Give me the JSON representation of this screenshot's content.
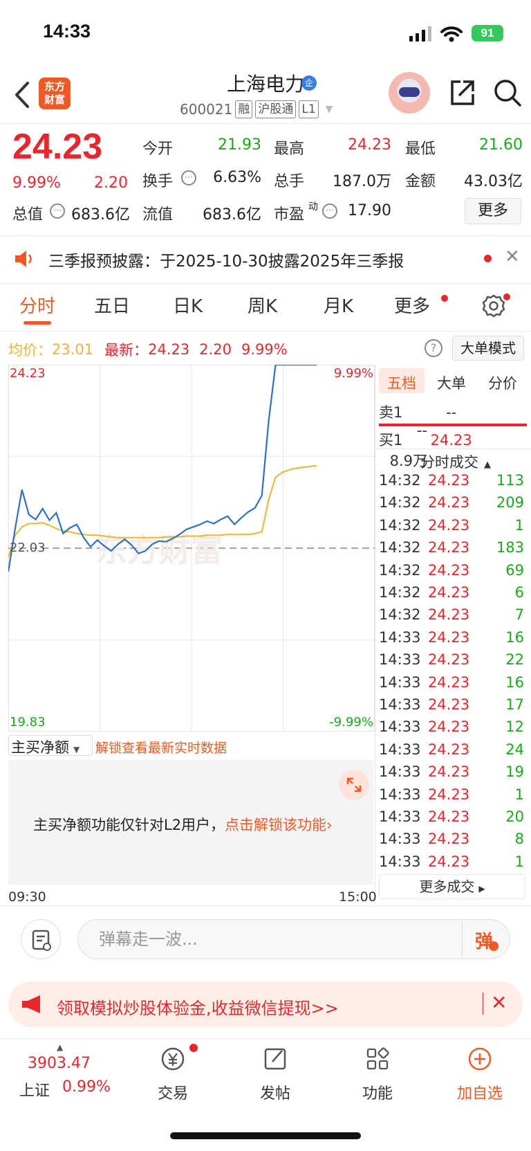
{
  "status_bar": {
    "time": "14:33",
    "battery": "91"
  },
  "header": {
    "logo_line1": "东方",
    "logo_line2": "财富",
    "stock_name": "上海电力",
    "name_badge": "企",
    "stock_code": "600021",
    "tags": [
      "融",
      "沪股通",
      "L1"
    ]
  },
  "quote": {
    "price": "24.23",
    "change_pct": "9.99%",
    "change": "2.20",
    "open_label": "今开",
    "open": "21.93",
    "high_label": "最高",
    "high": "24.23",
    "low_label": "最低",
    "low": "21.60",
    "turnover_label": "换手",
    "turnover": "6.63%",
    "volume_label": "总手",
    "volume": "187.0万",
    "amount_label": "金额",
    "amount": "43.03亿",
    "mktcap_label": "总值",
    "mktcap": "683.6亿",
    "float_label": "流值",
    "float_cap": "683.6亿",
    "pe_label": "市盈",
    "pe_sup": "动",
    "pe": "17.90",
    "more_label": "更多"
  },
  "notice": {
    "text": "三季报预披露：于2025-10-30披露2025年三季报"
  },
  "tabs": [
    "分时",
    "五日",
    "日K",
    "周K",
    "月K",
    "更多"
  ],
  "info": {
    "avg_label": "均价：",
    "avg": "23.01",
    "latest_label": "最新：",
    "latest": "24.23",
    "latest_chg": "2.20",
    "latest_pct": "9.99%",
    "mode_label": "大单模式",
    "help_icon": "?"
  },
  "chart_data": {
    "type": "line",
    "title": "",
    "y_top_label": "24.23",
    "y_mid_label": "22.03",
    "y_bottom_label": "19.83",
    "pct_top_label": "9.99%",
    "pct_bottom_label": "-9.99%",
    "ylim": [
      19.83,
      24.23
    ],
    "prev_close": 22.03,
    "x_start_label": "09:30",
    "x_end_label": "15:00",
    "series": [
      {
        "color": "#2f6fc4",
        "values": [
          21.73,
          22.25,
          22.72,
          22.42,
          22.36,
          22.49,
          22.35,
          22.44,
          22.19,
          22.26,
          22.3,
          22.14,
          22.03,
          22.11,
          22.04,
          21.98,
          22.06,
          22.12,
          22.05,
          21.95,
          21.98,
          22.06,
          22.1,
          22.09,
          22.13,
          22.18,
          22.24,
          22.27,
          22.3,
          22.34,
          22.31,
          22.36,
          22.4,
          22.3,
          22.38,
          22.45,
          22.5,
          22.65,
          23.55,
          24.23,
          24.23,
          24.23,
          24.23,
          24.23,
          24.23,
          24.23
        ]
      },
      {
        "color": "#f2b332",
        "values": [
          21.9,
          22.17,
          22.27,
          22.31,
          22.31,
          22.32,
          22.29,
          22.25,
          22.22,
          22.21,
          22.19,
          22.18,
          22.17,
          22.17,
          22.16,
          22.15,
          22.14,
          22.14,
          22.14,
          22.14,
          22.14,
          22.14,
          22.14,
          22.15,
          22.15,
          22.15,
          22.16,
          22.16,
          22.16,
          22.17,
          22.17,
          22.17,
          22.18,
          22.18,
          22.18,
          22.18,
          22.19,
          22.21,
          22.6,
          22.87,
          22.93,
          22.96,
          22.98,
          22.99,
          23.0,
          23.01
        ]
      }
    ],
    "grid": true
  },
  "order_book": {
    "tabs": [
      "五档",
      "大单",
      "分价"
    ],
    "sell1_label": "卖1",
    "sell1_price": "--",
    "sell1_vol": "--",
    "buy1_label": "买1",
    "buy1_price": "24.23",
    "buy1_vol": "8.9万",
    "trades_title": "分时成交",
    "trades": [
      {
        "time": "14:32",
        "price": "24.23",
        "vol": "113"
      },
      {
        "time": "14:32",
        "price": "24.23",
        "vol": "209"
      },
      {
        "time": "14:32",
        "price": "24.23",
        "vol": "1"
      },
      {
        "time": "14:32",
        "price": "24.23",
        "vol": "183"
      },
      {
        "time": "14:32",
        "price": "24.23",
        "vol": "69"
      },
      {
        "time": "14:32",
        "price": "24.23",
        "vol": "6"
      },
      {
        "time": "14:32",
        "price": "24.23",
        "vol": "7"
      },
      {
        "time": "14:33",
        "price": "24.23",
        "vol": "16"
      },
      {
        "time": "14:33",
        "price": "24.23",
        "vol": "22"
      },
      {
        "time": "14:33",
        "price": "24.23",
        "vol": "16"
      },
      {
        "time": "14:33",
        "price": "24.23",
        "vol": "17"
      },
      {
        "time": "14:33",
        "price": "24.23",
        "vol": "12"
      },
      {
        "time": "14:33",
        "price": "24.23",
        "vol": "24"
      },
      {
        "time": "14:33",
        "price": "24.23",
        "vol": "19"
      },
      {
        "time": "14:33",
        "price": "24.23",
        "vol": "1"
      },
      {
        "time": "14:33",
        "price": "24.23",
        "vol": "20"
      },
      {
        "time": "14:33",
        "price": "24.23",
        "vol": "8"
      },
      {
        "time": "14:33",
        "price": "24.23",
        "vol": "1"
      }
    ],
    "more_trades": "更多成交"
  },
  "netflow": {
    "label": "主买净额",
    "unlock_link": "解锁查看最新实时数据",
    "notice_text": "主买净额功能仅针对L2用户，",
    "notice_link": "点击解锁该功能"
  },
  "comment": {
    "placeholder": "弹幕走一波...",
    "send_label": "弹"
  },
  "promo": {
    "text": "领取模拟炒股体验金,收益微信提现>>"
  },
  "bottom_nav": {
    "index_value": "3903.47",
    "index_name": "上证",
    "index_pct": "0.99%",
    "items": [
      "交易",
      "发帖",
      "功能",
      "加自选"
    ]
  },
  "colors": {
    "up": "#e8262c",
    "down": "#1aa81a",
    "brand": "#ef5a24",
    "price_line": "#2f6fc4",
    "avg_line": "#f2b332"
  }
}
